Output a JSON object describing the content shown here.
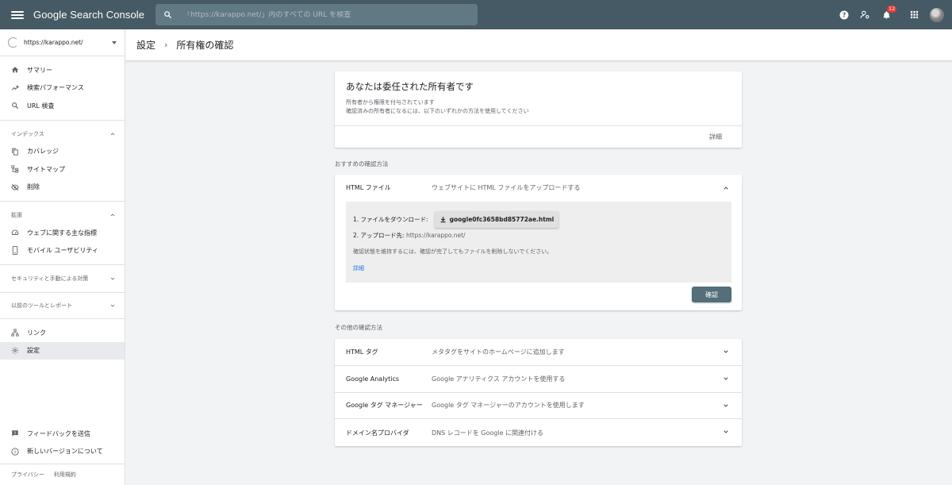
{
  "topbar": {
    "brand": "Google Search Console",
    "search_placeholder": "「https://karappo.net/」内のすべての URL を検査",
    "notification_count": "12",
    "icons": [
      "menu-icon",
      "search-icon",
      "help-icon",
      "manage-users-icon",
      "notifications-icon",
      "apps-icon",
      "avatar"
    ]
  },
  "sidebar": {
    "property": "https://karappo.net/",
    "main_items": [
      {
        "label": "サマリー",
        "icon": "home-icon"
      },
      {
        "label": "検索パフォーマンス",
        "icon": "trending-icon"
      },
      {
        "label": "URL 検査",
        "icon": "search-icon"
      }
    ],
    "index_heading": "インデックス",
    "index_items": [
      {
        "label": "カバレッジ",
        "icon": "copy-icon"
      },
      {
        "label": "サイトマップ",
        "icon": "sitemap-icon"
      },
      {
        "label": "削除",
        "icon": "eye-off-icon"
      }
    ],
    "enhance_heading": "拡張",
    "enhance_items": [
      {
        "label": "ウェブに関する主な指標",
        "icon": "speed-icon"
      },
      {
        "label": "モバイル ユーザビリティ",
        "icon": "phone-icon"
      }
    ],
    "security_heading": "セキュリティと手動による対策",
    "legacy_heading": "以前のツールとレポート",
    "other_items": [
      {
        "label": "リンク",
        "icon": "link-tree-icon"
      },
      {
        "label": "設定",
        "icon": "gear-icon",
        "active": true
      }
    ],
    "bottom_items": [
      {
        "label": "フィードバックを送信",
        "icon": "feedback-icon"
      },
      {
        "label": "新しいバージョンについて",
        "icon": "info-icon"
      }
    ],
    "footer": {
      "privacy": "プライバシー",
      "terms": "利用規約"
    }
  },
  "header": {
    "crumb1": "設定",
    "separator": "›",
    "crumb2": "所有権の確認"
  },
  "owner_card": {
    "title": "あなたは委任された所有者です",
    "line1": "所有者から権限を付与されています",
    "line2": "確認済みの所有者になるには、以下のいずれかの方法を使用してください",
    "detail_link": "詳細"
  },
  "recommended": {
    "section_label": "おすすめの確認方法",
    "method": "HTML ファイル",
    "description": "ウェブサイトに HTML ファイルをアップロードする",
    "step1": "1. ファイルをダウンロード:",
    "download_file": "google0fc3658bd85772ae.html",
    "step2": "2. アップロード先:",
    "upload_url": "https://karappo.net/",
    "note": "確認状態を維持するには、確認が完了してもファイルを削除しないでください。",
    "detail_link": "詳細",
    "confirm_button": "確認"
  },
  "other": {
    "section_label": "その他の確認方法",
    "methods": [
      {
        "name": "HTML タグ",
        "desc": "メタタグをサイトのホームページに追加します"
      },
      {
        "name": "Google Analytics",
        "desc": "Google アナリティクス アカウントを使用する"
      },
      {
        "name": "Google タグ マネージャー",
        "desc": "Google タグ マネージャーのアカウントを使用します"
      },
      {
        "name": "ドメイン名プロバイダ",
        "desc": "DNS レコードを Google に関連付ける"
      }
    ]
  }
}
